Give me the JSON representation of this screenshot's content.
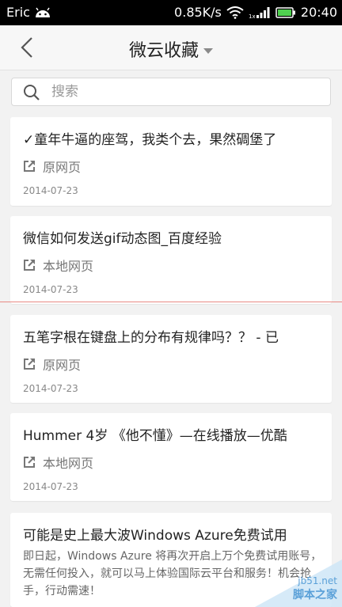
{
  "status_bar": {
    "carrier": "Eric",
    "network_speed": "0.85K/s",
    "signal_badge": "1x",
    "time": "20:40"
  },
  "header": {
    "title": "微云收藏"
  },
  "search": {
    "placeholder": "搜索"
  },
  "items": [
    {
      "title": "✓童年牛逼的座驾，我类个去，果然碉堡了",
      "source": "原网页",
      "date": "2014-07-23"
    },
    {
      "title": "微信如何发送gif动态图_百度经验",
      "source": "本地网页",
      "date": "2014-07-23"
    },
    {
      "title": "五笔字根在键盘上的分布有规律吗？？ - 已",
      "source": "原网页",
      "date": "2014-07-23"
    },
    {
      "title": "Hummer 4岁 《他不懂》—在线播放—优酷",
      "source": "本地网页",
      "date": "2014-07-23"
    },
    {
      "title": "可能是史上最大波Windows Azure免费试用",
      "summary": "即日起，Windows Azure 将再次开启上万个免费试用账号，无需任何投入，就可以马上体验国际云平台和服务！机会抢手，行动需速！"
    }
  ],
  "watermark": {
    "site": "jb51.net",
    "text": "脚本之家"
  }
}
